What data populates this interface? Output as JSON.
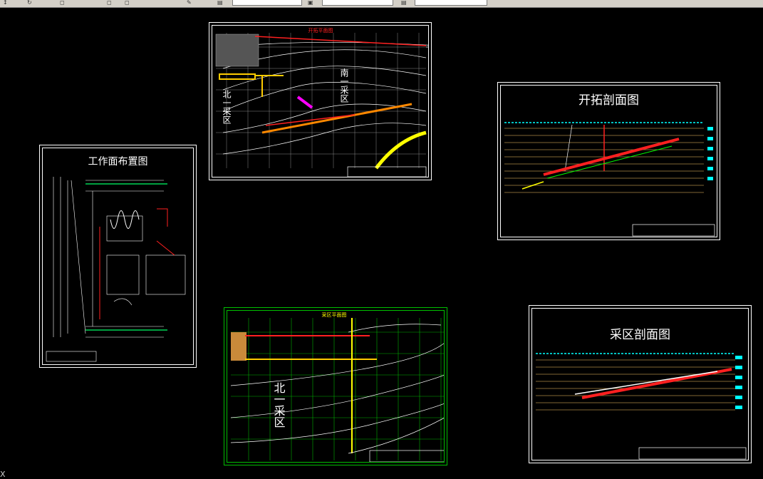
{
  "toolbar": {
    "icons": [
      "arrow-icon",
      "refresh-icon",
      "select-icon",
      "zoom-icon",
      "window-icon",
      "pan-icon",
      "brush-icon",
      "layer-icon"
    ],
    "fields": [
      "",
      "",
      "",
      ""
    ]
  },
  "sheets": {
    "work_face": {
      "title": "工作面布置图"
    },
    "development_section": {
      "title": "开拓剖面图"
    },
    "panel_section": {
      "title": "采区剖面图"
    },
    "top_plan": {
      "title": "开拓平面图",
      "label_north": "北一采区",
      "label_south": "南一采区"
    },
    "panel_plan": {
      "title": "采区平面图",
      "label_area": "北一采区"
    }
  },
  "command_line": {
    "prompt": "X"
  },
  "colors": {
    "background": "#000000",
    "frame": "#ffffff",
    "green": "#00c000",
    "red": "#ff2020",
    "yellow": "#ffff00",
    "cyan": "#00ffff"
  }
}
